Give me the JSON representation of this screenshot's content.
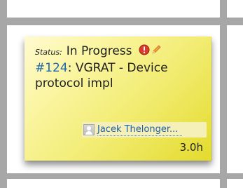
{
  "card": {
    "status_label": "Status:",
    "status_value": "In Progress",
    "issue_number": "#124",
    "issue_separator": ":",
    "issue_title": " VGRAT - Device protocol impl",
    "assignee_name": "Jacek Thelonger...",
    "estimate": "3.0h"
  },
  "icons": {
    "priority": "exclamation-circle-icon",
    "edit": "pencil-icon",
    "avatar": "user-avatar-icon"
  },
  "colors": {
    "card_fill_light": "#fffad0",
    "card_fill_dark": "#e3db2c",
    "grid_line": "#a7a7a7",
    "link": "#1e66b0",
    "priority_red": "#d93a2b"
  }
}
